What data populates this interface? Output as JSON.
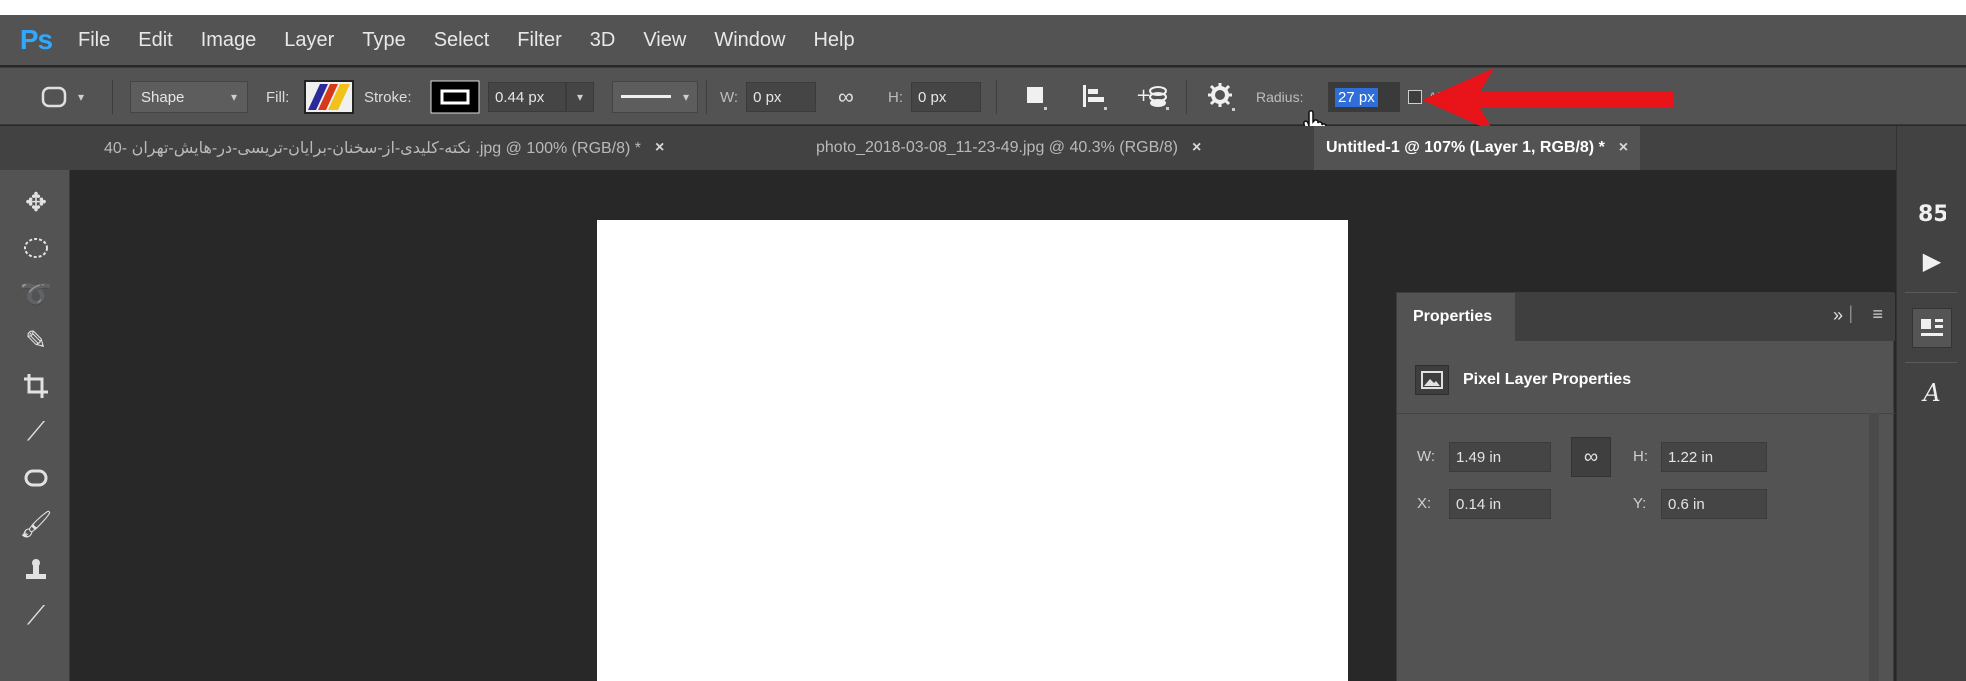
{
  "app": {
    "logo": "Ps"
  },
  "menu": [
    "File",
    "Edit",
    "Image",
    "Layer",
    "Type",
    "Select",
    "Filter",
    "3D",
    "View",
    "Window",
    "Help"
  ],
  "options": {
    "mode": "Shape",
    "fill_label": "Fill:",
    "stroke_label": "Stroke:",
    "stroke_width": "0.44 px",
    "w_label": "W:",
    "w_value": "0 px",
    "h_label": "H:",
    "h_value": "0 px",
    "radius_label": "Radius:",
    "radius_value": "27 px",
    "align_edges_label": "Align Edges"
  },
  "tabs": [
    {
      "label": "40- نکته-کلیدی-از-سخنان-برایان-تریسی-در-هایش-تهران .jpg @ 100% (RGB/8) *",
      "close": "×"
    },
    {
      "label": "photo_2018-03-08_11-23-49.jpg @ 40.3% (RGB/8)",
      "close": "×"
    },
    {
      "label": "Untitled-1 @ 107% (Layer 1, RGB/8) *",
      "close": "×"
    }
  ],
  "tools": [
    "move",
    "ellipse-marquee",
    "lasso",
    "quick-select",
    "crop",
    "eyedropper",
    "spot-heal",
    "brush",
    "clone-stamp",
    "history-brush"
  ],
  "properties": {
    "tab_label": "Properties",
    "title": "Pixel Layer Properties",
    "w_label": "W:",
    "w_value": "1.49 in",
    "h_label": "H:",
    "h_value": "1.22 in",
    "x_label": "X:",
    "x_value": "0.14 in",
    "y_label": "Y:",
    "y_value": "0.6 in",
    "link_glyph": "∞",
    "collapse_glyph": "»",
    "menu_glyph": "≡"
  },
  "colors": {
    "menubar": "#535353",
    "workspace": "#282828",
    "panel": "#535353",
    "ps_blue": "#31a8ff",
    "arrow_red": "#e8141a",
    "highlight": "#2f6ed8"
  }
}
